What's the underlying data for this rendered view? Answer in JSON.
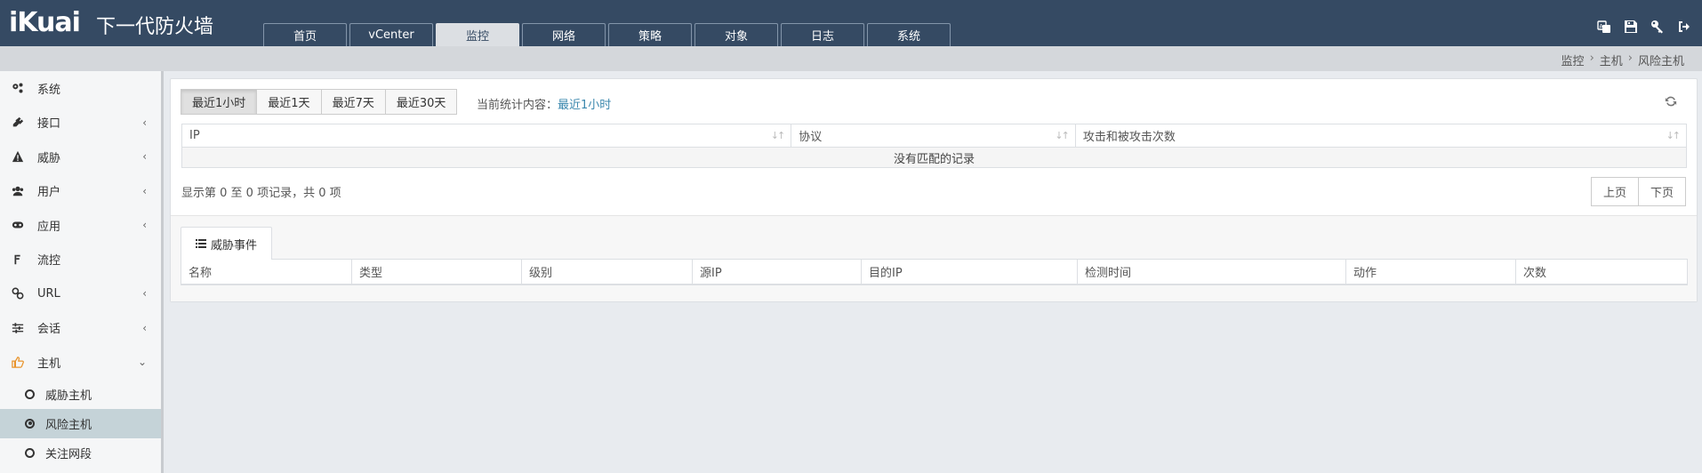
{
  "app": {
    "logo": "iKuai",
    "product_name": "下一代防火墙"
  },
  "nav": {
    "tabs": [
      {
        "label": "首页"
      },
      {
        "label": "vCenter"
      },
      {
        "label": "监控",
        "active": true
      },
      {
        "label": "网络"
      },
      {
        "label": "策略"
      },
      {
        "label": "对象"
      },
      {
        "label": "日志"
      },
      {
        "label": "系统"
      }
    ],
    "icons": [
      "translate-icon",
      "save-icon",
      "key-icon",
      "logout-icon"
    ]
  },
  "breadcrumb": {
    "items": [
      "监控",
      "主机",
      "风险主机"
    ],
    "separator": "›"
  },
  "sidebar": {
    "items": [
      {
        "label": "系统",
        "icon": "gears-icon",
        "has_children": false
      },
      {
        "label": "接口",
        "icon": "plug-icon",
        "has_children": true
      },
      {
        "label": "威胁",
        "icon": "warning-icon",
        "has_children": true
      },
      {
        "label": "用户",
        "icon": "users-icon",
        "has_children": true
      },
      {
        "label": "应用",
        "icon": "gamepad-icon",
        "has_children": true
      },
      {
        "label": "流控",
        "icon": "flow-icon",
        "has_children": false
      },
      {
        "label": "URL",
        "icon": "link-icon",
        "has_children": true
      },
      {
        "label": "会话",
        "icon": "sliders-icon",
        "has_children": true
      },
      {
        "label": "主机",
        "icon": "hand-point-icon",
        "has_children": true,
        "open": true
      }
    ],
    "sub_items": [
      {
        "label": "威胁主机",
        "active": false
      },
      {
        "label": "风险主机",
        "active": true
      },
      {
        "label": "关注网段",
        "active": false
      }
    ],
    "accent_color": "#e8932a"
  },
  "main": {
    "time_buttons": [
      {
        "label": "最近1小时",
        "active": true
      },
      {
        "label": "最近1天",
        "active": false
      },
      {
        "label": "最近7天",
        "active": false
      },
      {
        "label": "最近30天",
        "active": false
      }
    ],
    "current_stat_label": "当前统计内容：",
    "current_stat_value": "最近1小时",
    "table1": {
      "columns": [
        "IP",
        "协议",
        "攻击和被攻击次数"
      ],
      "empty_text": "没有匹配的记录"
    },
    "page_info": "显示第 0 至 0 项记录，共 0 项",
    "pager": {
      "prev": "上页",
      "next": "下页"
    },
    "tab2_label": "威胁事件",
    "table2": {
      "columns": [
        "名称",
        "类型",
        "级别",
        "源IP",
        "目的IP",
        "检测时间",
        "动作",
        "次数"
      ]
    }
  },
  "colors": {
    "topbar": "#354a63",
    "link": "#3a87ad"
  }
}
